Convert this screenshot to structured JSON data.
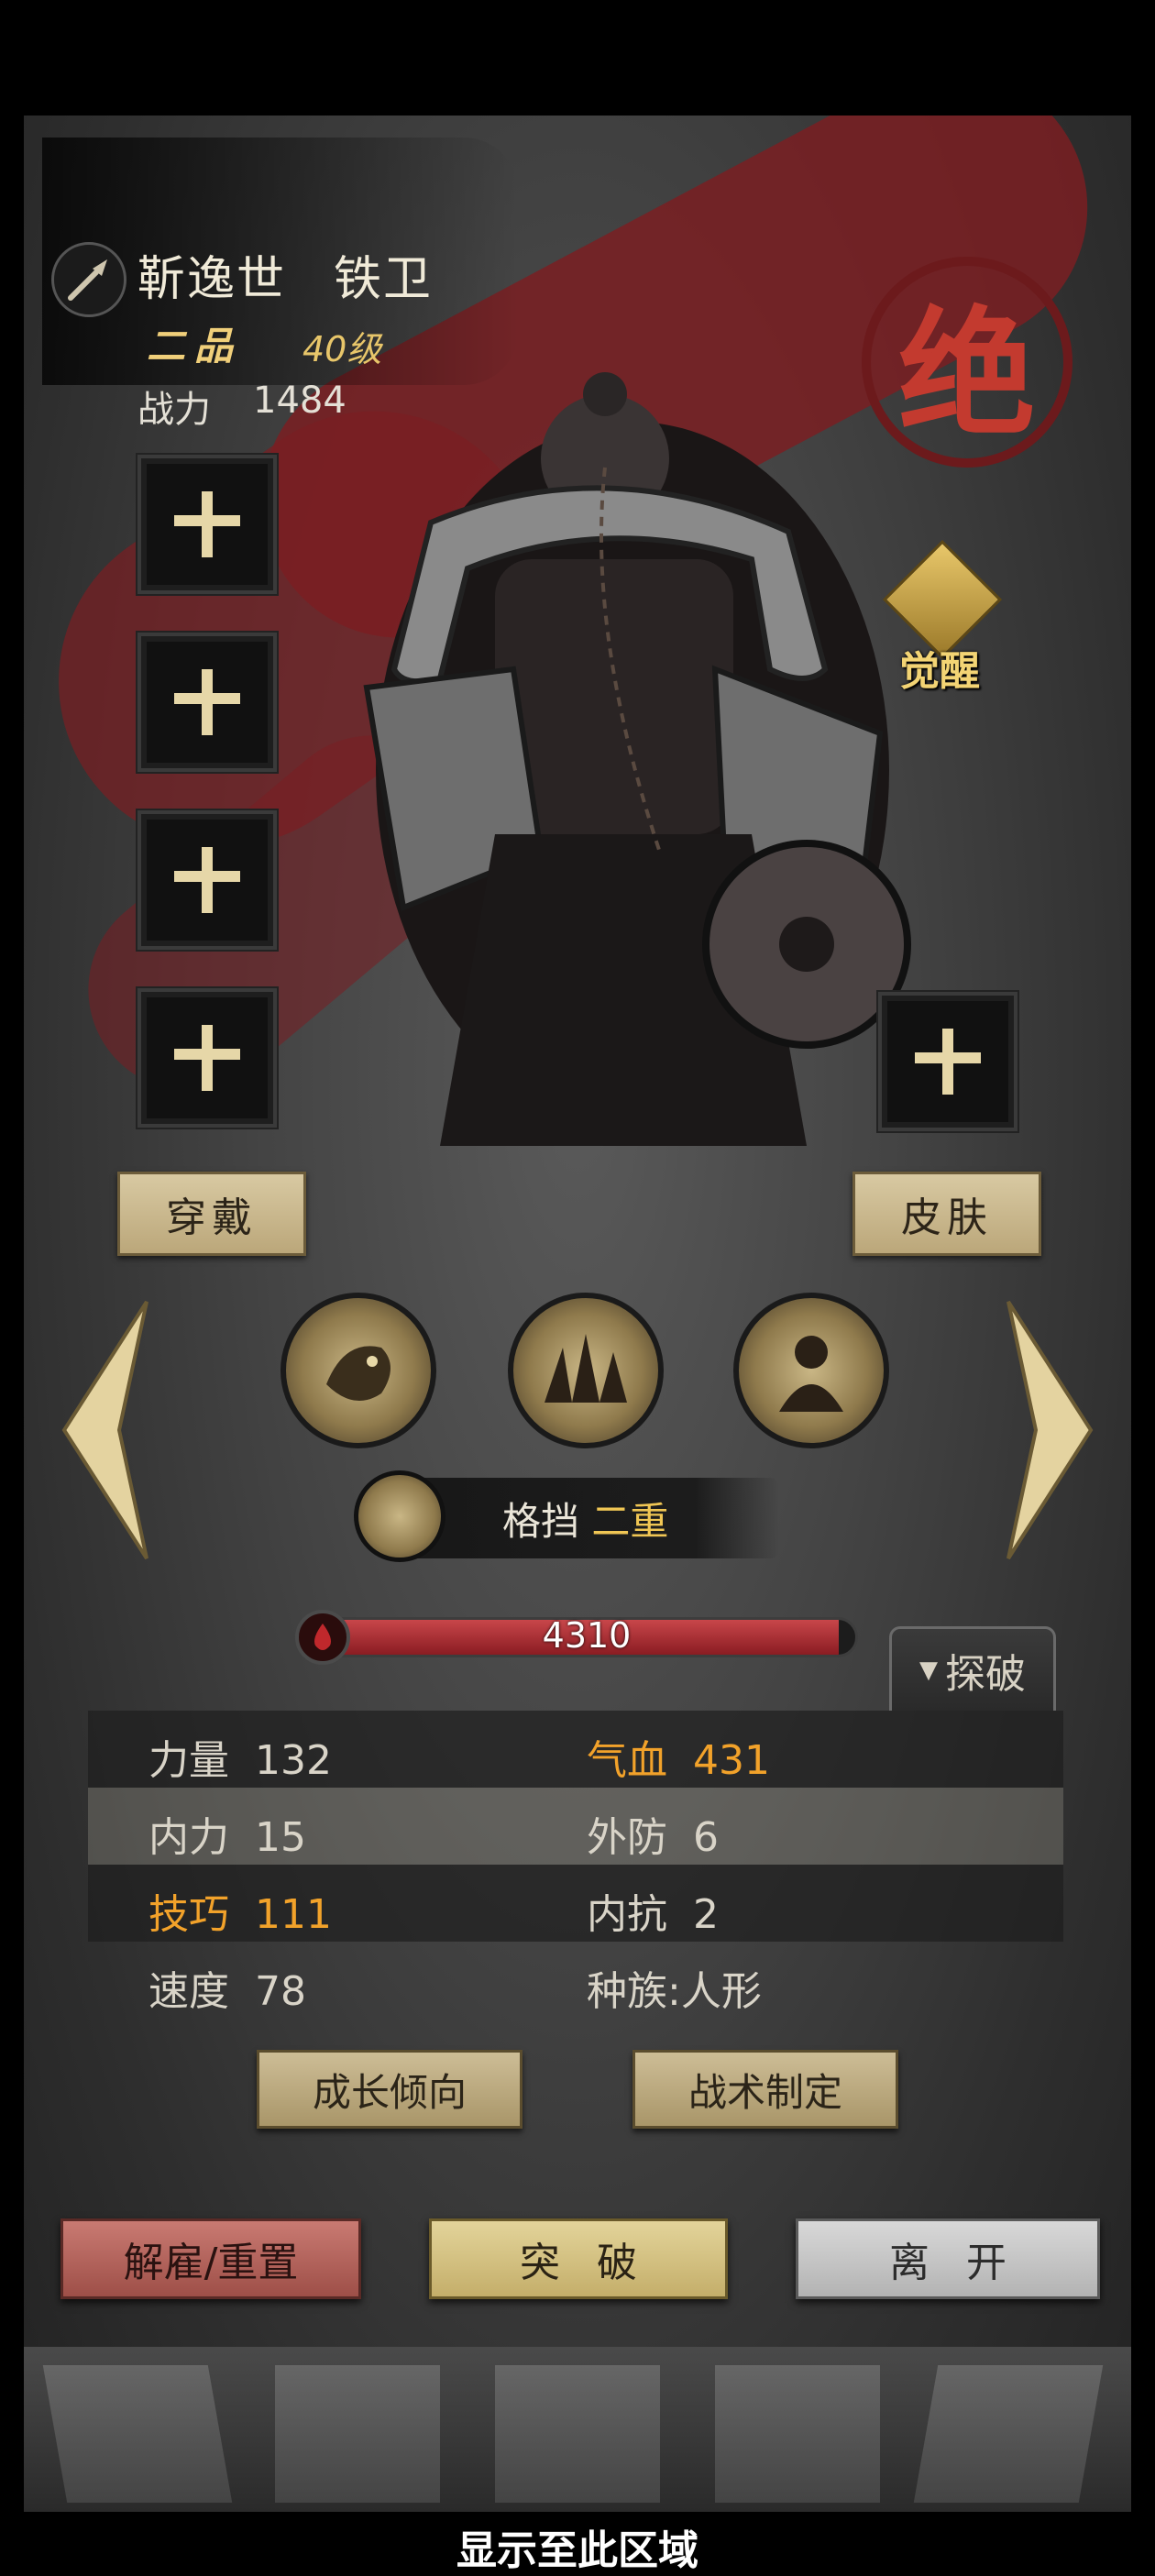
{
  "hero": {
    "name": "靳逸世",
    "class": "铁卫",
    "grade": "二品",
    "level": "40级",
    "power_label": "战力",
    "power_value": "1484",
    "rank_seal": "绝",
    "weapon_icon": "brush-weapon-icon"
  },
  "awaken": {
    "label": "觉醒",
    "icon": "muscle-figure-icon"
  },
  "equipment_slots": [
    {
      "icon": "plus-icon"
    },
    {
      "icon": "plus-icon"
    },
    {
      "icon": "plus-icon"
    },
    {
      "icon": "plus-icon"
    },
    {
      "icon": "plus-icon"
    }
  ],
  "buttons": {
    "wear": "穿戴",
    "skin": "皮肤",
    "growth": "成长倾向",
    "tactics": "战术制定",
    "dismiss": "解雇/重置",
    "breakthrough": "突破",
    "leave": "离开"
  },
  "skills": {
    "icons": [
      "tiger-skill-icon",
      "spikes-skill-icon",
      "armored-figure-skill-icon"
    ],
    "selected_name": "格挡",
    "selected_level": "二重",
    "selected_icon": "block-skill-icon"
  },
  "hp": {
    "value": "4310",
    "fill_fraction": 0.97
  },
  "explore_tab": "探破",
  "stats": {
    "strength_label": "力量",
    "strength_value": "132",
    "hp_label": "气血",
    "hp_value": "431",
    "inner_label": "内力",
    "inner_value": "15",
    "outer_def_label": "外防",
    "outer_def_value": "6",
    "skill_label": "技巧",
    "skill_value": "111",
    "inner_res_label": "内抗",
    "inner_res_value": "2",
    "speed_label": "速度",
    "speed_value": "78",
    "race_label": "种族:",
    "race_value": "人形"
  },
  "colors": {
    "highlight_stat": "#f2a22a",
    "seal_red": "#c33a2f",
    "ink_red": "#7a1e22"
  },
  "footer_note": "显示至此区域"
}
